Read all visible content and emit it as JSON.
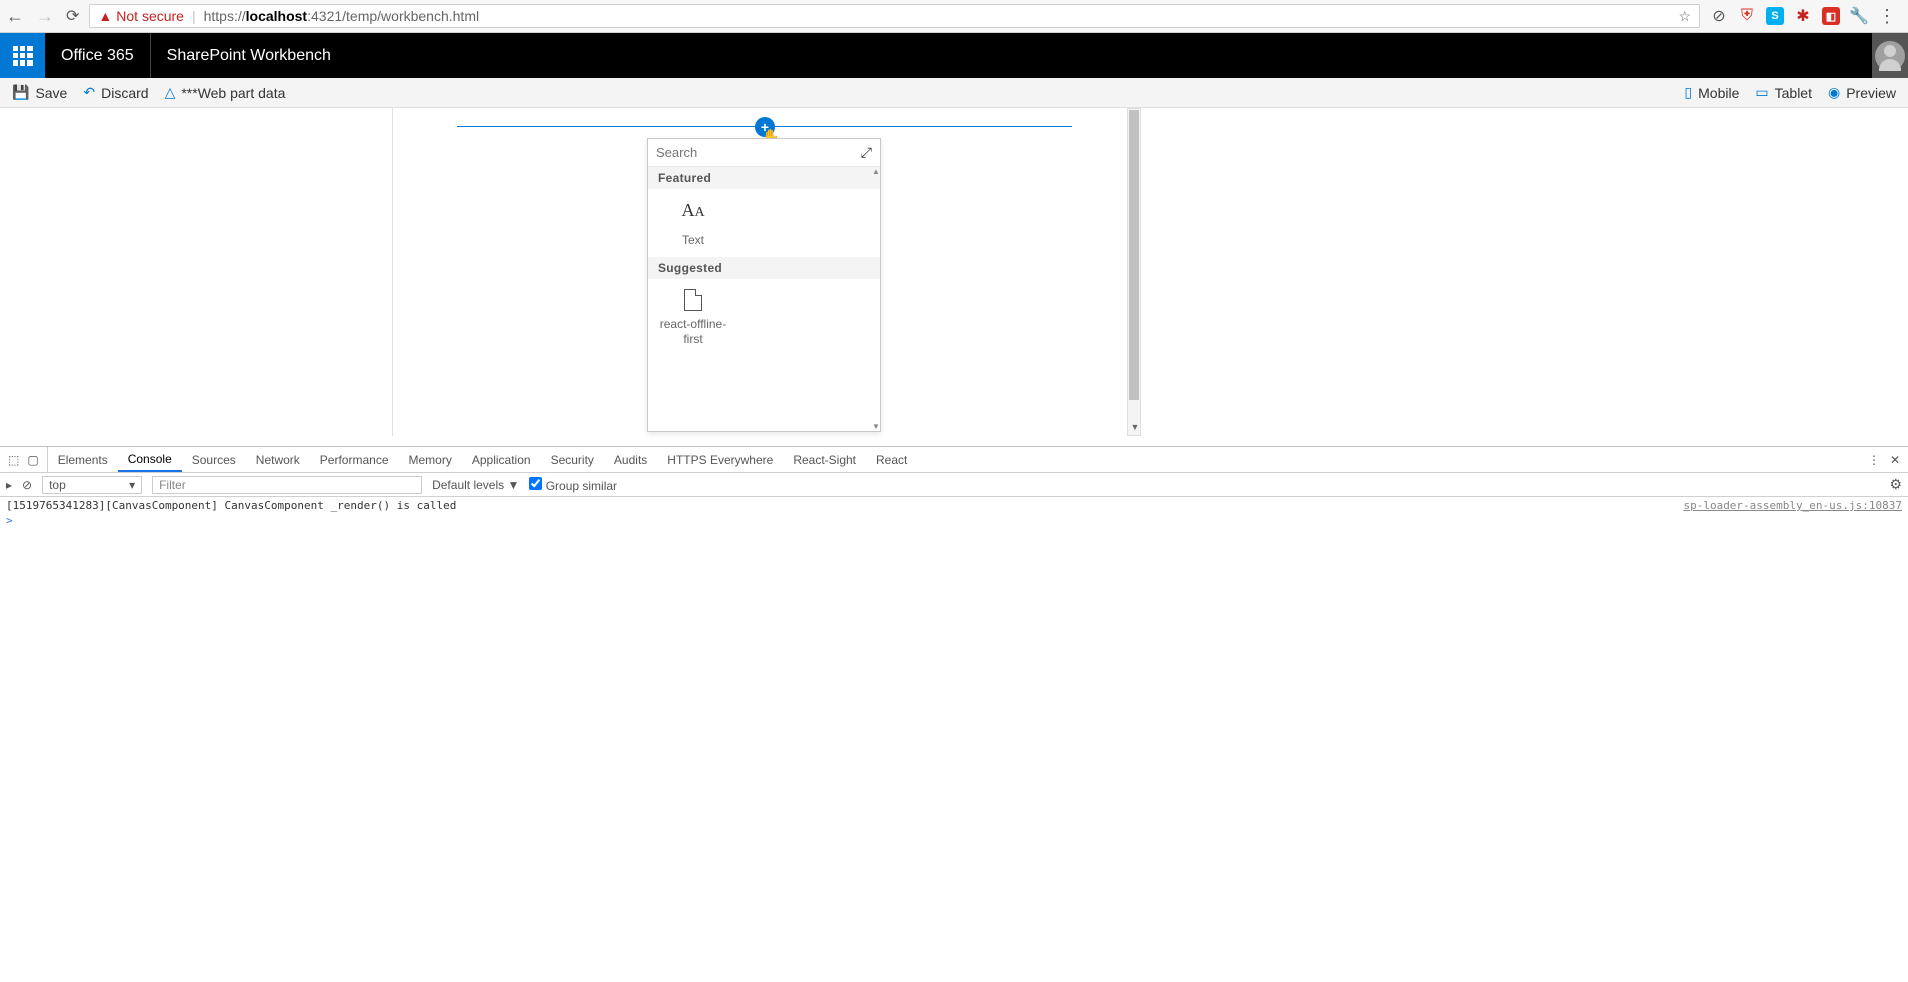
{
  "browser": {
    "not_secure": "Not secure",
    "url_prefix": "https://",
    "url_host": "localhost",
    "url_rest": ":4321/temp/workbench.html"
  },
  "o365": {
    "brand": "Office 365",
    "app": "SharePoint Workbench"
  },
  "commandbar": {
    "save": "Save",
    "discard": "Discard",
    "webpartdata": "***Web part data",
    "mobile": "Mobile",
    "tablet": "Tablet",
    "preview": "Preview"
  },
  "picker": {
    "search_placeholder": "Search",
    "featured_header": "Featured",
    "suggested_header": "Suggested",
    "text_label": "Text",
    "react_label": "react-offline-first"
  },
  "devtools": {
    "tabs": {
      "elements": "Elements",
      "console": "Console",
      "sources": "Sources",
      "network": "Network",
      "performance": "Performance",
      "memory": "Memory",
      "application": "Application",
      "security": "Security",
      "audits": "Audits",
      "https": "HTTPS Everywhere",
      "reactsight": "React-Sight",
      "react": "React"
    },
    "context": "top",
    "filter_placeholder": "Filter",
    "levels": "Default levels ▼",
    "group_similar": "Group similar",
    "log_msg": "[1519765341283][CanvasComponent] CanvasComponent _render() is called",
    "log_src": "sp-loader-assembly_en-us.js:10837",
    "prompt": ">"
  }
}
